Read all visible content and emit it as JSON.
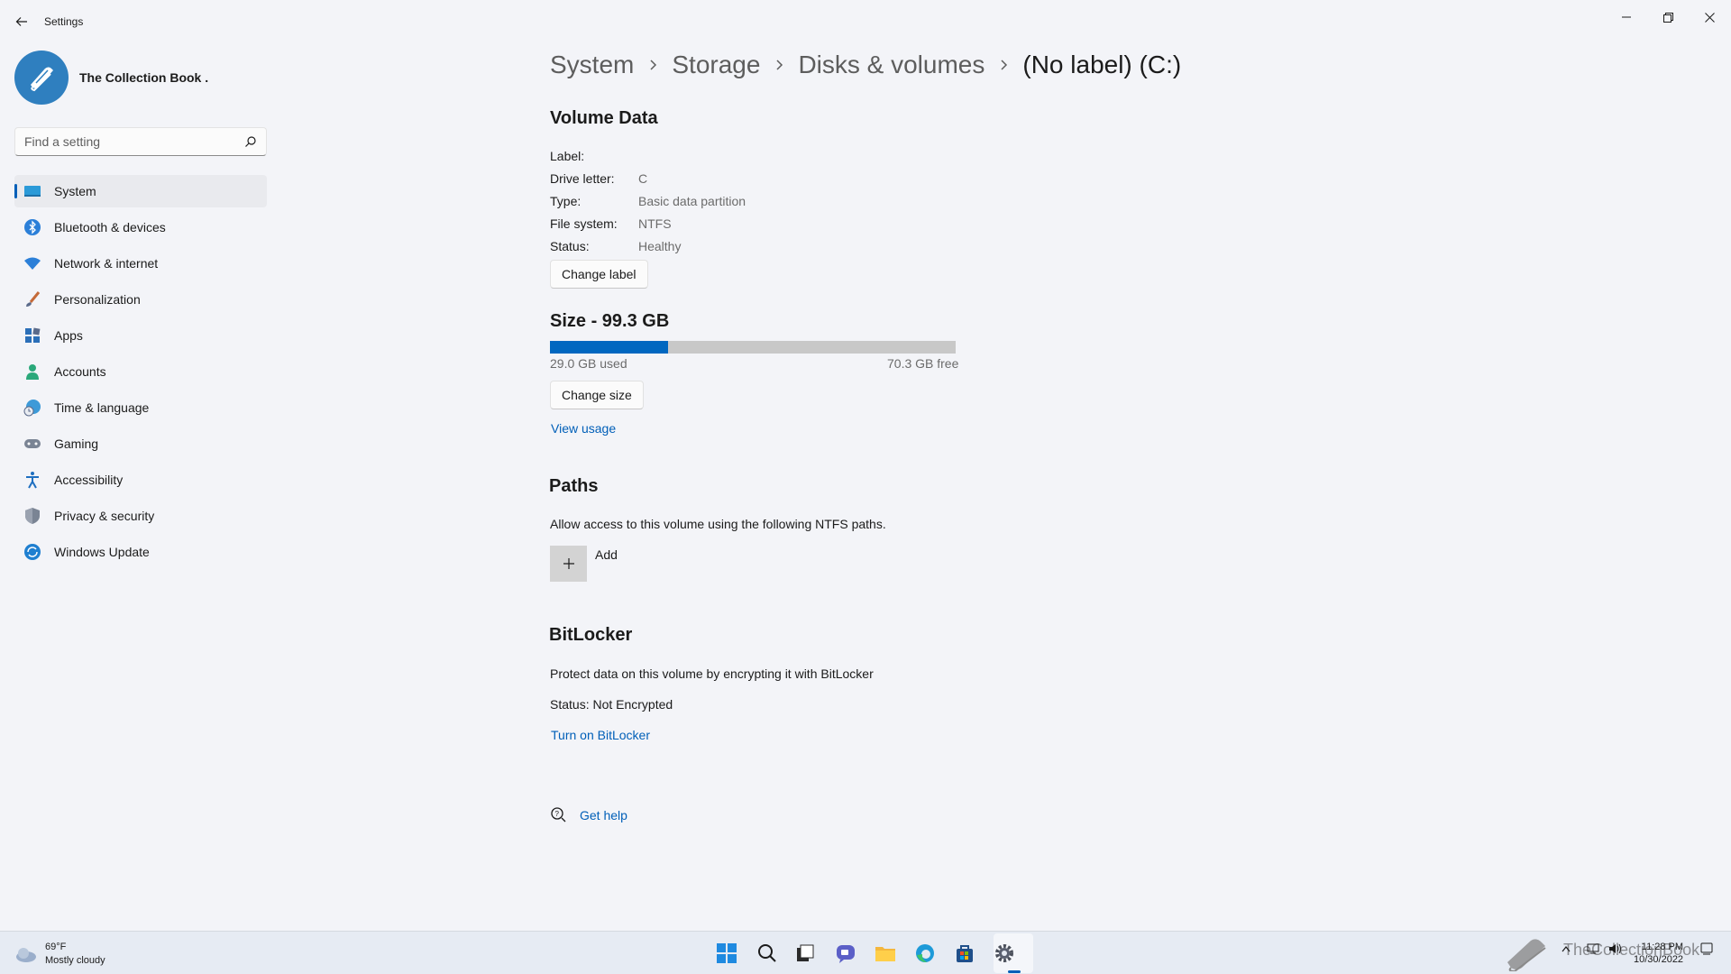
{
  "window": {
    "title": "Settings"
  },
  "profile": {
    "name": "The Collection Book ."
  },
  "search": {
    "placeholder": "Find a setting"
  },
  "sidebar": {
    "items": [
      {
        "label": "System",
        "icon": "system-icon",
        "active": true
      },
      {
        "label": "Bluetooth & devices",
        "icon": "bluetooth-icon"
      },
      {
        "label": "Network & internet",
        "icon": "wifi-icon"
      },
      {
        "label": "Personalization",
        "icon": "brush-icon"
      },
      {
        "label": "Apps",
        "icon": "apps-icon"
      },
      {
        "label": "Accounts",
        "icon": "person-icon"
      },
      {
        "label": "Time & language",
        "icon": "globe-clock-icon"
      },
      {
        "label": "Gaming",
        "icon": "gamepad-icon"
      },
      {
        "label": "Accessibility",
        "icon": "accessibility-icon"
      },
      {
        "label": "Privacy & security",
        "icon": "shield-icon"
      },
      {
        "label": "Windows Update",
        "icon": "update-icon"
      }
    ]
  },
  "breadcrumb": [
    "System",
    "Storage",
    "Disks & volumes",
    "(No label) (C:)"
  ],
  "volume": {
    "title": "Volume Data",
    "fields": [
      {
        "key": "Label:",
        "value": ""
      },
      {
        "key": "Drive letter:",
        "value": "C"
      },
      {
        "key": "Type:",
        "value": "Basic data partition"
      },
      {
        "key": "File system:",
        "value": "NTFS"
      },
      {
        "key": "Status:",
        "value": "Healthy"
      }
    ],
    "change_label": "Change label"
  },
  "size": {
    "title": "Size - 99.3 GB",
    "used_label": "29.0 GB used",
    "free_label": "70.3 GB free",
    "used_fraction": 0.292,
    "change_size": "Change size",
    "view_usage": "View usage"
  },
  "paths": {
    "title": "Paths",
    "description": "Allow access to this volume using the following NTFS paths.",
    "add_label": "Add"
  },
  "bitlocker": {
    "title": "BitLocker",
    "description": "Protect data on this volume by encrypting it with BitLocker",
    "status": "Status: Not Encrypted",
    "turn_on": "Turn on BitLocker"
  },
  "help": {
    "label": "Get help"
  },
  "taskbar": {
    "weather_temp": "69°F",
    "weather_desc": "Mostly cloudy",
    "time": "11:28 PM",
    "date": "10/30/2022",
    "watermark": "TheCollectionBook",
    "colors": {
      "accent": "#005fb8",
      "bar_used": "#0067c0"
    }
  }
}
